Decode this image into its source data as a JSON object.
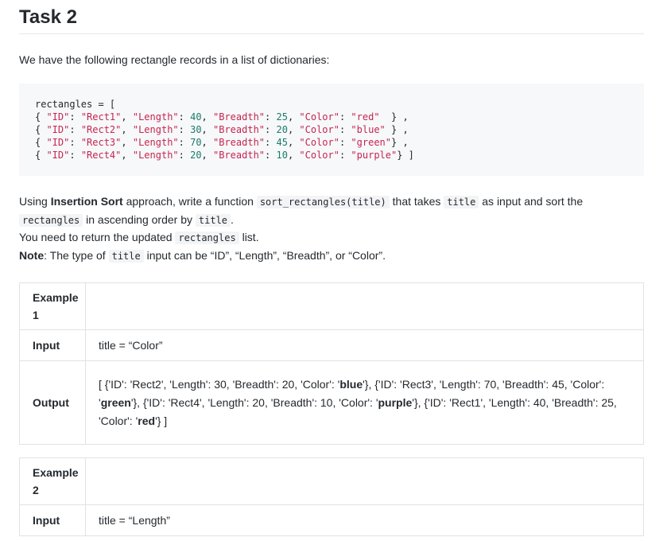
{
  "title": "Task 2",
  "intro": "We have the following rectangle records in a list of dictionaries:",
  "code": {
    "header": "rectangles = [",
    "rows": [
      {
        "id": "\"Rect1\"",
        "length": "40",
        "breadth": "25",
        "color": "\"red\"",
        "tail": "  } ,"
      },
      {
        "id": "\"Rect2\"",
        "length": "30",
        "breadth": "20",
        "color": "\"blue\"",
        "tail": " } ,"
      },
      {
        "id": "\"Rect3\"",
        "length": "70",
        "breadth": "45",
        "color": "\"green\"",
        "tail": "} ,"
      },
      {
        "id": "\"Rect4\"",
        "length": "20",
        "breadth": "10",
        "color": "\"purple\"",
        "tail": "} ]"
      }
    ]
  },
  "description": {
    "line1_pre": "Using ",
    "line1_bold": "Insertion Sort",
    "line1_mid": " approach, write a function ",
    "line1_code1": "sort_rectangles(title)",
    "line1_mid2": " that takes ",
    "line1_code2": "title",
    "line1_post": " as input and sort the",
    "line2_code": "rectangles",
    "line2_mid": " in ascending order by ",
    "line2_code2": "title",
    "line2_post": ".",
    "line3_pre": "You need to return the updated ",
    "line3_code": "rectangles",
    "line3_post": " list.",
    "note_bold": "Note",
    "note_pre": ": The type of ",
    "note_code": "title",
    "note_post": " input can be “ID”, “Length”, “Breadth”, or “Color”."
  },
  "examples": [
    {
      "label": "Example 1",
      "input_label": "Input",
      "input_value": "title = “Color”",
      "output_label": "Output",
      "output_segments": [
        {
          "t": "[ {'ID': 'Rect2', 'Length': 30, 'Breadth': 20, 'Color': '"
        },
        {
          "b": "blue"
        },
        {
          "t": "'}, {'ID': 'Rect3', 'Length': 70, 'Breadth': 45, 'Color': '"
        },
        {
          "b": "green"
        },
        {
          "t": "'}, {'ID': 'Rect4', 'Length': 20, 'Breadth': 10, 'Color': '"
        },
        {
          "b": "purple"
        },
        {
          "t": "'}, {'ID': 'Rect1', 'Length': 40, 'Breadth': 25, 'Color': '"
        },
        {
          "b": "red"
        },
        {
          "t": "'} ]"
        }
      ]
    },
    {
      "label": "Example 2",
      "input_label": "Input",
      "input_value": "title = “Length”"
    }
  ]
}
